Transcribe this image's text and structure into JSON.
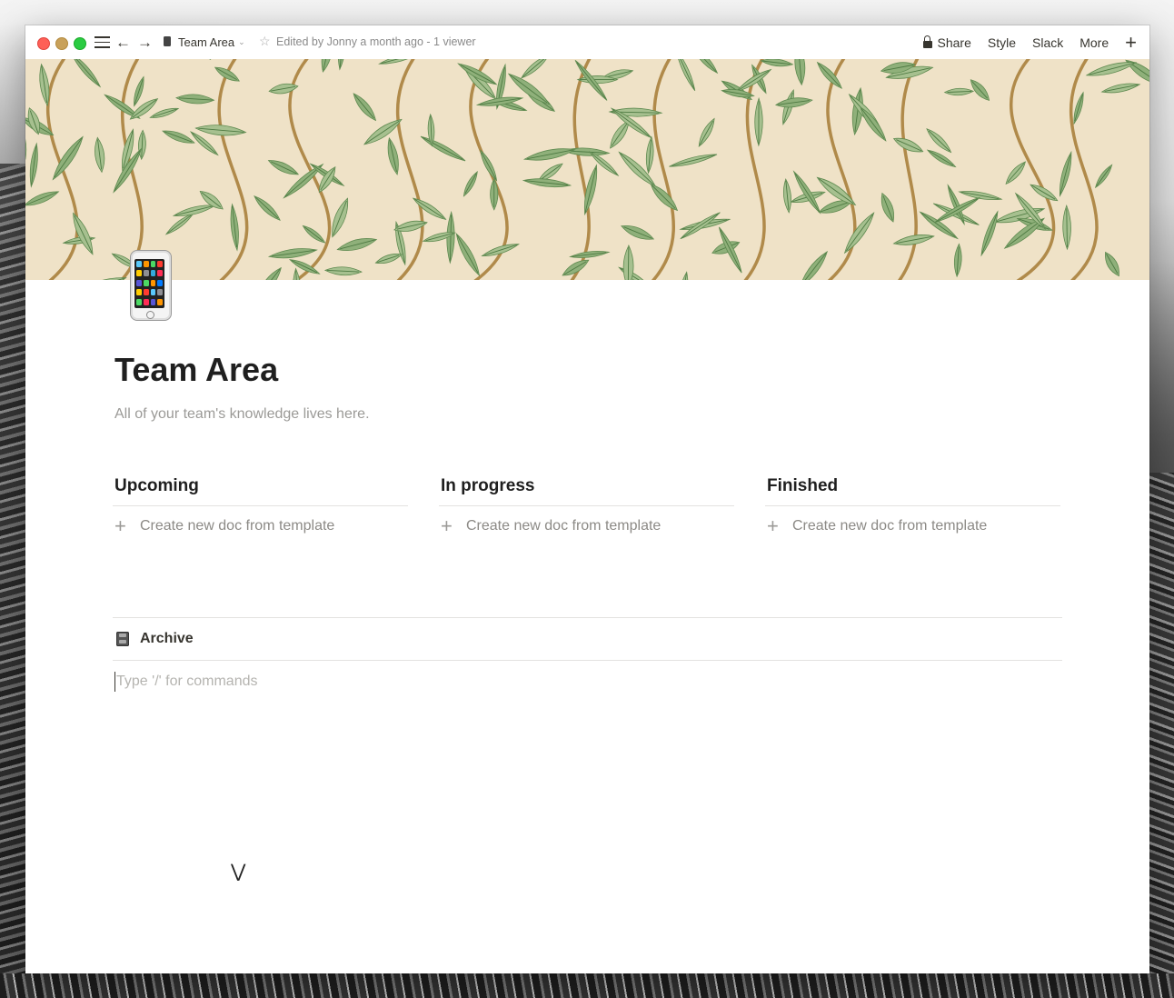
{
  "window": {
    "breadcrumb_title": "Team Area",
    "edited_status": "Edited by Jonny a month ago - 1 viewer",
    "menu": {
      "share": "Share",
      "style": "Style",
      "slack": "Slack",
      "more": "More",
      "add": "+"
    }
  },
  "page": {
    "icon": "mobile-phone-icon",
    "title": "Team Area",
    "description": "All of your team's knowledge lives here."
  },
  "board": {
    "columns": [
      {
        "title": "Upcoming",
        "create_label": "Create new doc from template"
      },
      {
        "title": "In progress",
        "create_label": "Create new doc from template"
      },
      {
        "title": "Finished",
        "create_label": "Create new doc from template"
      }
    ]
  },
  "archive": {
    "label": "Archive",
    "icon": "file-cabinet-icon"
  },
  "editor": {
    "placeholder": "Type '/' for commands"
  },
  "colors": {
    "cover_bg": "#efe2c7",
    "leaf": "#8fb07a",
    "stem": "#b08a4a",
    "text": "#37352f",
    "muted": "#9b9a97"
  }
}
